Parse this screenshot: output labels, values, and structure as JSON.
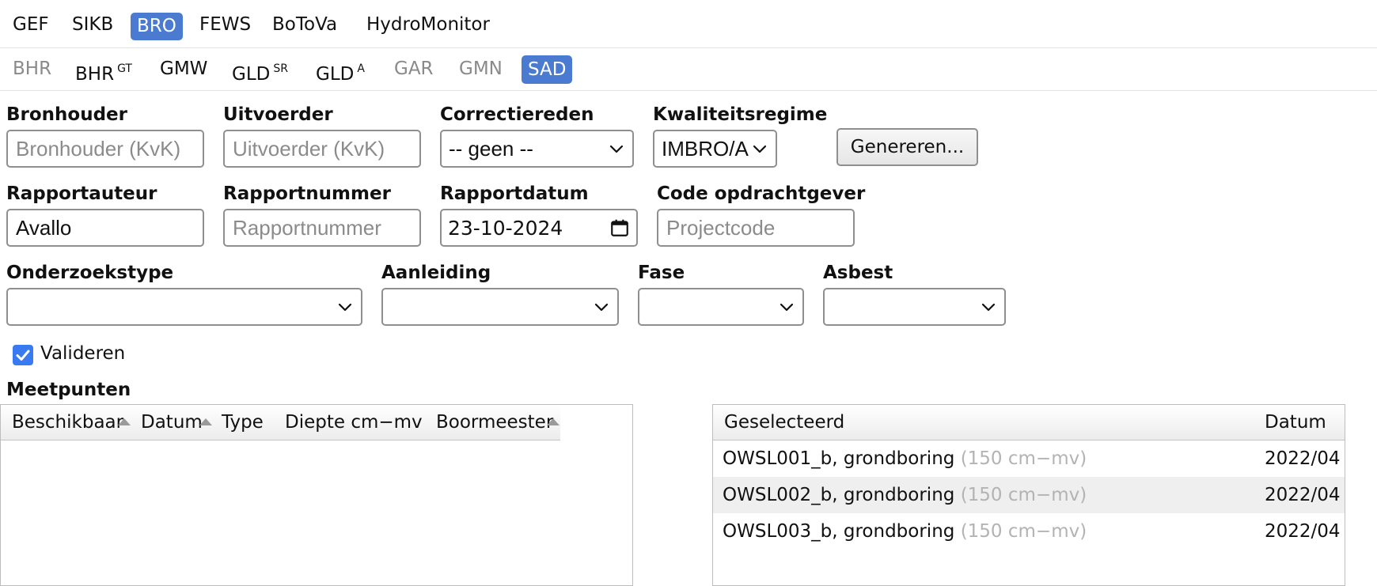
{
  "nav_primary": [
    {
      "label": "GEF",
      "active": false
    },
    {
      "label": "SIKB",
      "active": false
    },
    {
      "label": "BRO",
      "active": true
    },
    {
      "label": "FEWS",
      "active": false
    },
    {
      "label": "BoToVa",
      "active": false
    },
    {
      "label": "HydroMonitor",
      "active": false
    }
  ],
  "nav_secondary": [
    {
      "label": "BHR",
      "sup": "",
      "state": "disabled"
    },
    {
      "label": "BHR",
      "sup": "GT",
      "state": "normal"
    },
    {
      "label": "GMW",
      "sup": "",
      "state": "normal"
    },
    {
      "label": "GLD",
      "sup": "SR",
      "state": "normal"
    },
    {
      "label": "GLD",
      "sup": "A",
      "state": "normal"
    },
    {
      "label": "GAR",
      "sup": "",
      "state": "disabled"
    },
    {
      "label": "GMN",
      "sup": "",
      "state": "disabled"
    },
    {
      "label": "SAD",
      "sup": "",
      "state": "active"
    }
  ],
  "form": {
    "bronhouder": {
      "label": "Bronhouder",
      "placeholder": "Bronhouder (KvK)",
      "value": ""
    },
    "uitvoerder": {
      "label": "Uitvoerder",
      "placeholder": "Uitvoerder (KvK)",
      "value": ""
    },
    "correctiereden": {
      "label": "Correctiereden",
      "value": "-- geen --"
    },
    "kwaliteitsregime": {
      "label": "Kwaliteitsregime",
      "value": "IMBRO/A"
    },
    "genereren_label": "Genereren...",
    "rapportauteur": {
      "label": "Rapportauteur",
      "placeholder": "",
      "value": "Avallo"
    },
    "rapportnummer": {
      "label": "Rapportnummer",
      "placeholder": "Rapportnummer",
      "value": ""
    },
    "rapportdatum": {
      "label": "Rapportdatum",
      "value": "23-10-2024"
    },
    "code_opdrachtgever": {
      "label": "Code opdrachtgever",
      "placeholder": "Projectcode",
      "value": ""
    },
    "onderzoekstype": {
      "label": "Onderzoekstype",
      "value": ""
    },
    "aanleiding": {
      "label": "Aanleiding",
      "value": ""
    },
    "fase": {
      "label": "Fase",
      "value": ""
    },
    "asbest": {
      "label": "Asbest",
      "value": ""
    },
    "valideren": {
      "label": "Valideren",
      "checked": true
    }
  },
  "meetpunten": {
    "title": "Meetpunten",
    "available_columns": [
      "Beschikbaar",
      "Datum",
      "Type",
      "Diepte cm−mv",
      "Boormeester"
    ],
    "selected_columns": [
      "Geselecteerd",
      "Datum"
    ],
    "selected_rows": [
      {
        "name": "OWSL001_b, grondboring",
        "depth": "(150 cm−mv)",
        "date": "2022/04"
      },
      {
        "name": "OWSL002_b, grondboring",
        "depth": "(150 cm−mv)",
        "date": "2022/04"
      },
      {
        "name": "OWSL003_b, grondboring",
        "depth": "(150 cm−mv)",
        "date": "2022/04"
      }
    ]
  },
  "icons": {
    "select_arrow": "chevron-down-icon",
    "date_picker": "calendar-icon",
    "sort_indicator": "sort-asc-icon",
    "checkbox": "checkmark-icon"
  },
  "colors": {
    "active_tab": "#4a7bd0",
    "checkbox": "#3a7af0",
    "row_stripe": "#efefef",
    "muted_text": "#b3b3b3"
  }
}
